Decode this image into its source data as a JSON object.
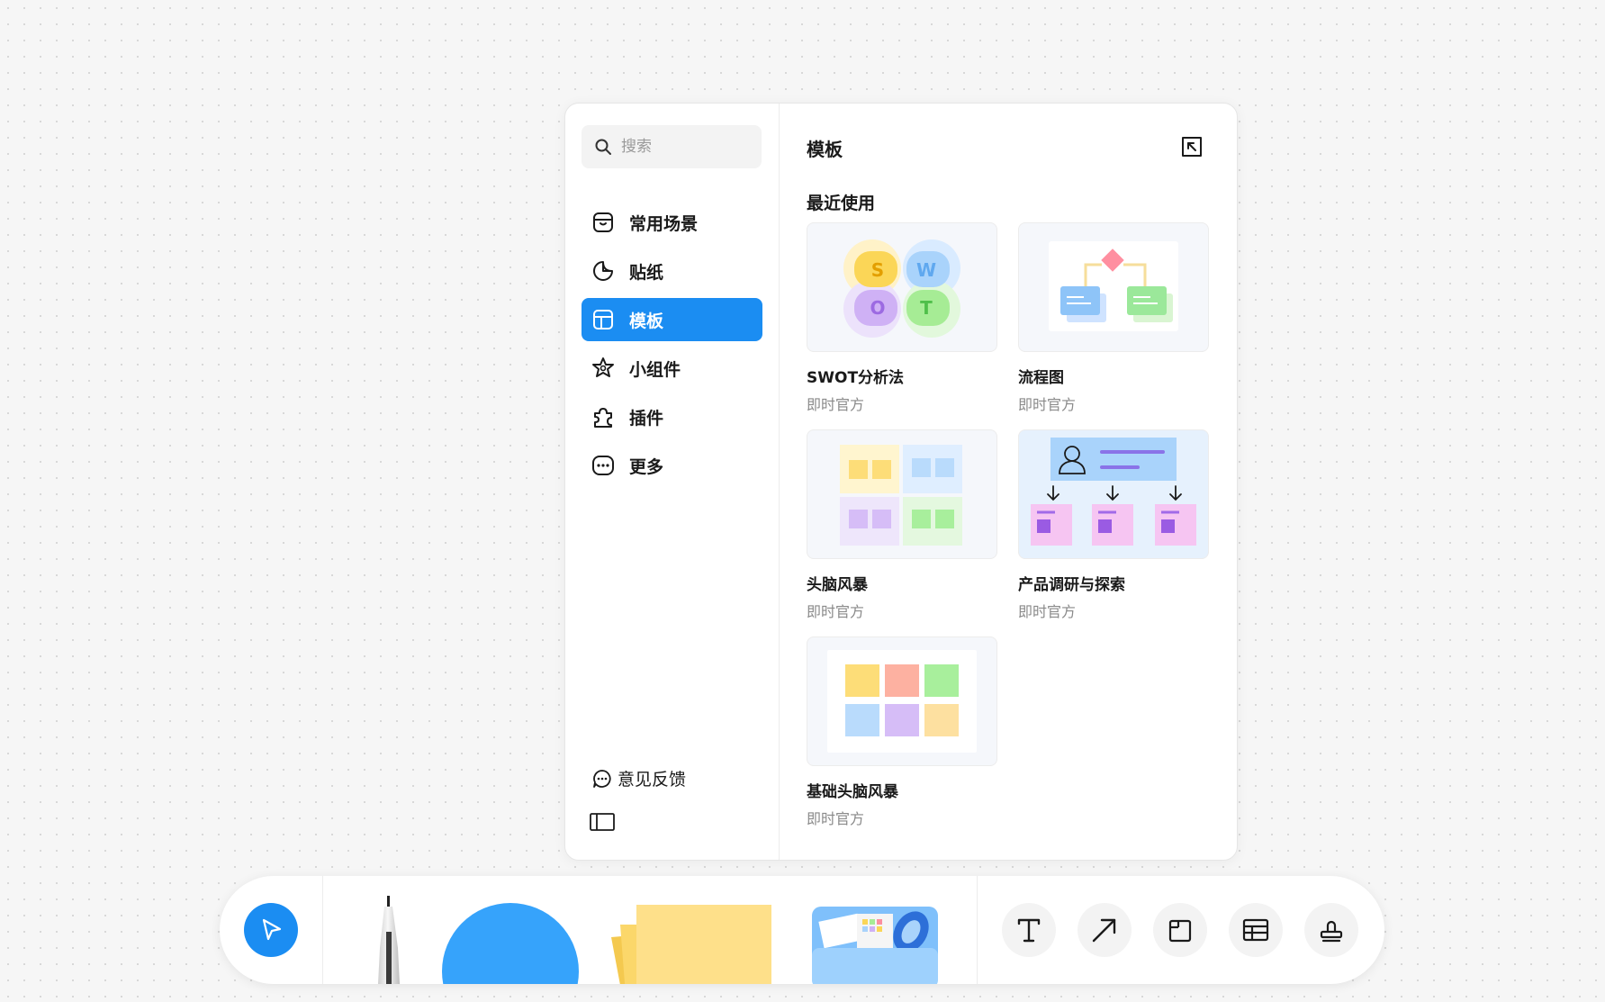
{
  "search": {
    "placeholder": "搜索"
  },
  "sidebar": {
    "items": [
      {
        "label": "常用场景",
        "icon": "box-icon",
        "active": false
      },
      {
        "label": "贴纸",
        "icon": "sticker-icon",
        "active": false
      },
      {
        "label": "模板",
        "icon": "template-icon",
        "active": true
      },
      {
        "label": "小组件",
        "icon": "widget-icon",
        "active": false
      },
      {
        "label": "插件",
        "icon": "plugin-icon",
        "active": false
      },
      {
        "label": "更多",
        "icon": "more-icon",
        "active": false
      }
    ],
    "feedback_label": "意见反馈"
  },
  "main": {
    "title": "模板",
    "section_title": "最近使用",
    "cards": [
      {
        "name": "SWOT分析法",
        "source": "即时官方",
        "letters": [
          "S",
          "W",
          "O",
          "T"
        ]
      },
      {
        "name": "流程图",
        "source": "即时官方"
      },
      {
        "name": "头脑风暴",
        "source": "即时官方"
      },
      {
        "name": "产品调研与探索",
        "source": "即时官方"
      },
      {
        "name": "基础头脑风暴",
        "source": "即时官方"
      }
    ]
  },
  "toolbar": {
    "tools": [
      "select-tool",
      "pen-tool",
      "shape-tool",
      "sticky-note-tool",
      "asset-folder-tool",
      "text-tool",
      "arrow-tool",
      "frame-tool",
      "table-tool",
      "stamp-tool"
    ]
  },
  "colors": {
    "accent": "#1b8df2",
    "canvas": "#f6f6f6"
  }
}
